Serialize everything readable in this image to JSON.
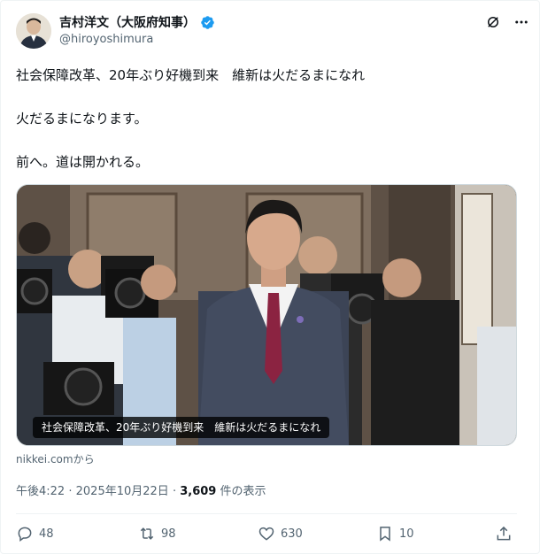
{
  "author": {
    "display_name": "吉村洋文（大阪府知事）",
    "handle": "@hiroyoshimura",
    "verified_color": "#1d9bf0"
  },
  "header_icons": [
    "grok-icon",
    "more-icon"
  ],
  "tweet": {
    "lines": [
      "社会保障改革、20年ぶり好機到来　維新は火だるまになれ",
      "火だるまになります。",
      "前へ。道は開かれる。"
    ]
  },
  "media": {
    "caption": "社会保障改革、20年ぶり好機到来　維新は火だるまになれ",
    "source": "nikkei.comから"
  },
  "meta": {
    "time": "午後4:22",
    "separator": "·",
    "date": "2025年10月22日",
    "views_count": "3,609",
    "views_label": "件の表示"
  },
  "actions": {
    "replies": "48",
    "reposts": "98",
    "likes": "630",
    "bookmarks": "10"
  }
}
